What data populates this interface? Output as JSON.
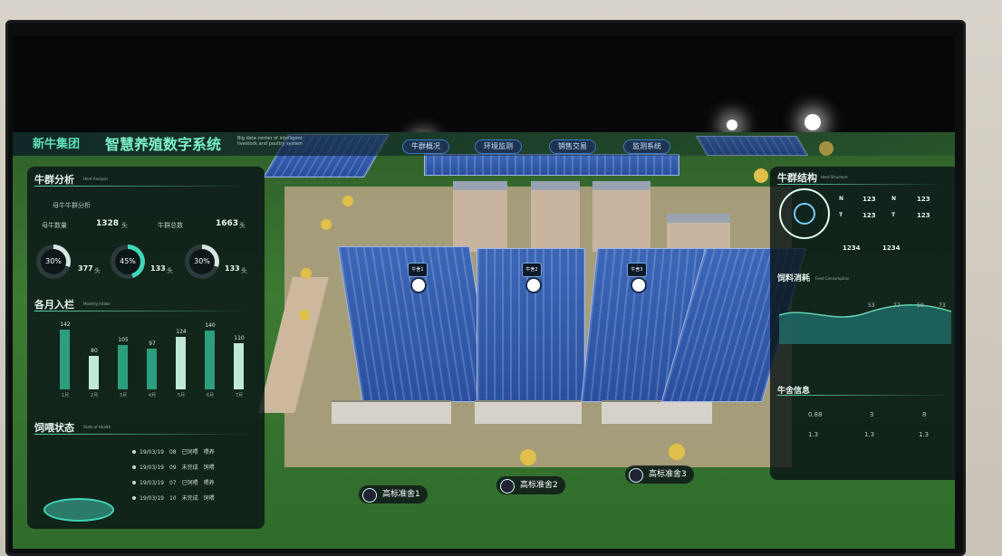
{
  "header": {
    "brand": "新牛集团",
    "title": "智慧养殖数字系统",
    "subtitle": "Big data center of intelligent livestock and poultry system",
    "nav": [
      "牛群概况",
      "环境监测",
      "销售交易",
      "监测系统"
    ]
  },
  "left_panel": {
    "herd_title": "牛群分析",
    "herd_sub": "Herd Analysis",
    "legend_label": "母牛牛群分析",
    "stat1_label": "母牛数量",
    "stat1_value": "1328",
    "stat1_unit": "头",
    "stat2_label": "牛群总数",
    "stat2_value": "1663",
    "stat2_unit": "头",
    "gauges": [
      {
        "pct": "30%",
        "value": "377",
        "unit": "头",
        "color": "#d8e6e2"
      },
      {
        "pct": "45%",
        "value": "133",
        "unit": "头",
        "color": "#3fd6b8"
      },
      {
        "pct": "30%",
        "value": "133",
        "unit": "头",
        "color": "#d8e6e2"
      }
    ],
    "monthly_title": "各月入栏",
    "monthly_sub": "Monthly Intake",
    "bars": [
      {
        "label": "1月",
        "value": 142
      },
      {
        "label": "2月",
        "value": 80
      },
      {
        "label": "3月",
        "value": 105
      },
      {
        "label": "4月",
        "value": 97
      },
      {
        "label": "5月",
        "value": 124
      },
      {
        "label": "6月",
        "value": 140
      },
      {
        "label": "7月",
        "value": 110
      }
    ],
    "health_title": "饲喂状态",
    "health_sub": "State of Health",
    "health_rows": [
      {
        "date": "19/03/19",
        "num": "08",
        "a": "已饲喂",
        "b": "喂养"
      },
      {
        "date": "19/03/19",
        "num": "09",
        "a": "未完成",
        "b": "饲喂"
      },
      {
        "date": "19/03/19",
        "num": "07",
        "a": "已饲喂",
        "b": "喂养"
      },
      {
        "date": "19/03/19",
        "num": "10",
        "a": "未完成",
        "b": "饲喂"
      }
    ]
  },
  "right_panel": {
    "title": "牛群结构",
    "sub": "Herd Structure",
    "stats": [
      {
        "k": "N",
        "v": "123"
      },
      {
        "k": "N",
        "v": "123"
      },
      {
        "k": "T",
        "v": "123"
      },
      {
        "k": "T",
        "v": "123"
      },
      {
        "k": "",
        "v": "1234"
      },
      {
        "k": "",
        "v": "1234"
      }
    ],
    "feed_title": "饲料消耗",
    "feed_sub": "Feed Consumption",
    "feed_values": [
      "53",
      "77",
      "50",
      "73"
    ],
    "env_title": "牛舍信息",
    "env_items": [
      "0.88",
      "1.3",
      "1.3",
      "1.3",
      "8",
      "3"
    ]
  },
  "zones": [
    "高标准舍1",
    "高标准舍2",
    "高标准舍3"
  ],
  "pins": [
    "牛舍1",
    "牛舍2",
    "牛舍3"
  ]
}
